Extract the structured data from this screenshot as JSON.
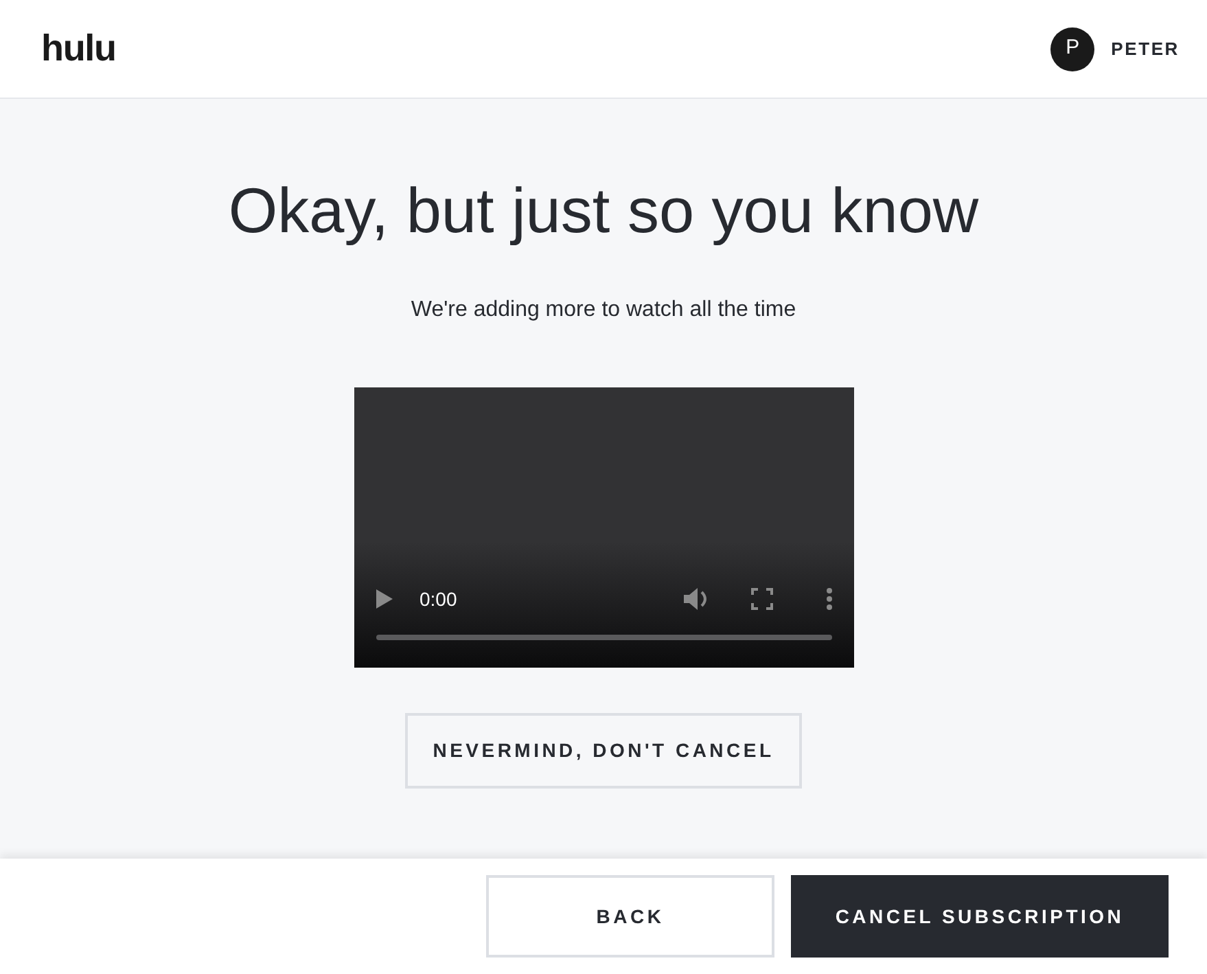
{
  "header": {
    "logo": "hulu",
    "user": {
      "initial": "P",
      "name": "PETER"
    }
  },
  "heading": "Okay, but just so you know",
  "subtitle": "We're adding more to watch all the time",
  "video": {
    "time": "0:00",
    "level": 0
  },
  "stay_button": "NEVERMIND, DON'T CANCEL",
  "footer": {
    "buttons": [
      {
        "label": "BACK",
        "kind": "secondary"
      },
      {
        "label": "CANCEL SUBSCRIPTION",
        "kind": "primary"
      }
    ]
  }
}
